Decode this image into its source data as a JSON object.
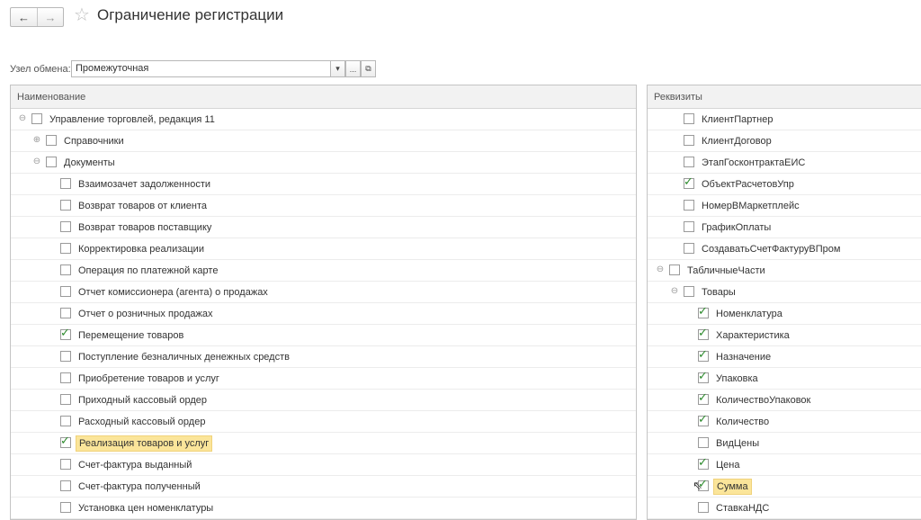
{
  "header": {
    "back_icon": "←",
    "forward_icon": "→",
    "star_icon": "☆",
    "title": "Ограничение регистрации"
  },
  "exchange_node": {
    "label": "Узел обмена:",
    "value": "Промежуточная",
    "dropdown_icon": "▾",
    "ellipsis": "...",
    "open_icon": "⧉"
  },
  "left_panel": {
    "header": "Наименование",
    "rows": [
      {
        "label": "Управление торговлей, редакция 11",
        "level": 0,
        "expander": "⊖",
        "checked": false
      },
      {
        "label": "Справочники",
        "level": 1,
        "expander": "⊕",
        "checked": false
      },
      {
        "label": "Документы",
        "level": 1,
        "expander": "⊖",
        "checked": false
      },
      {
        "label": "Взаимозачет задолженности",
        "level": 2,
        "checked": false
      },
      {
        "label": "Возврат товаров от клиента",
        "level": 2,
        "checked": false
      },
      {
        "label": "Возврат товаров поставщику",
        "level": 2,
        "checked": false
      },
      {
        "label": "Корректировка реализации",
        "level": 2,
        "checked": false
      },
      {
        "label": "Операция по платежной карте",
        "level": 2,
        "checked": false
      },
      {
        "label": "Отчет комиссионера (агента) о продажах",
        "level": 2,
        "checked": false
      },
      {
        "label": "Отчет о розничных продажах",
        "level": 2,
        "checked": false
      },
      {
        "label": "Перемещение товаров",
        "level": 2,
        "checked": true
      },
      {
        "label": "Поступление безналичных денежных средств",
        "level": 2,
        "checked": false
      },
      {
        "label": "Приобретение товаров и услуг",
        "level": 2,
        "checked": false
      },
      {
        "label": "Приходный кассовый ордер",
        "level": 2,
        "checked": false
      },
      {
        "label": "Расходный кассовый ордер",
        "level": 2,
        "checked": false
      },
      {
        "label": "Реализация товаров и услуг",
        "level": 2,
        "checked": true,
        "highlight": true
      },
      {
        "label": "Счет-фактура выданный",
        "level": 2,
        "checked": false
      },
      {
        "label": "Счет-фактура полученный",
        "level": 2,
        "checked": false
      },
      {
        "label": "Установка цен номенклатуры",
        "level": 2,
        "checked": false
      }
    ]
  },
  "right_panel": {
    "header": "Реквизиты",
    "rows": [
      {
        "label": "КлиентПартнер",
        "level": 1,
        "checked": false
      },
      {
        "label": "КлиентДоговор",
        "level": 1,
        "checked": false
      },
      {
        "label": "ЭтапГосконтрактаЕИС",
        "level": 1,
        "checked": false
      },
      {
        "label": "ОбъектРасчетовУпр",
        "level": 1,
        "checked": true
      },
      {
        "label": "НомерВМаркетплейс",
        "level": 1,
        "checked": false
      },
      {
        "label": "ГрафикОплаты",
        "level": 1,
        "checked": false
      },
      {
        "label": "СоздаватьСчетФактуруВПром",
        "level": 1,
        "checked": false
      },
      {
        "label": "ТабличныеЧасти",
        "level": 0,
        "expander": "⊖",
        "checked": false
      },
      {
        "label": "Товары",
        "level": 1,
        "expander": "⊖",
        "checked": false
      },
      {
        "label": "Номенклатура",
        "level": 2,
        "checked": true
      },
      {
        "label": "Характеристика",
        "level": 2,
        "checked": true
      },
      {
        "label": "Назначение",
        "level": 2,
        "checked": true
      },
      {
        "label": "Упаковка",
        "level": 2,
        "checked": true
      },
      {
        "label": "КоличествоУпаковок",
        "level": 2,
        "checked": true
      },
      {
        "label": "Количество",
        "level": 2,
        "checked": true
      },
      {
        "label": "ВидЦены",
        "level": 2,
        "checked": false
      },
      {
        "label": "Цена",
        "level": 2,
        "checked": true
      },
      {
        "label": "Сумма",
        "level": 2,
        "checked": true,
        "highlight": true,
        "cursor": true
      },
      {
        "label": "СтавкаНДС",
        "level": 2,
        "checked": false
      }
    ]
  },
  "icons": {
    "check": "✓",
    "mouse_cursor": "⇖"
  },
  "colors": {
    "checkmark": "#2e8b2e",
    "highlight": "#fbe59a",
    "header_bg": "#f2f2f2"
  }
}
